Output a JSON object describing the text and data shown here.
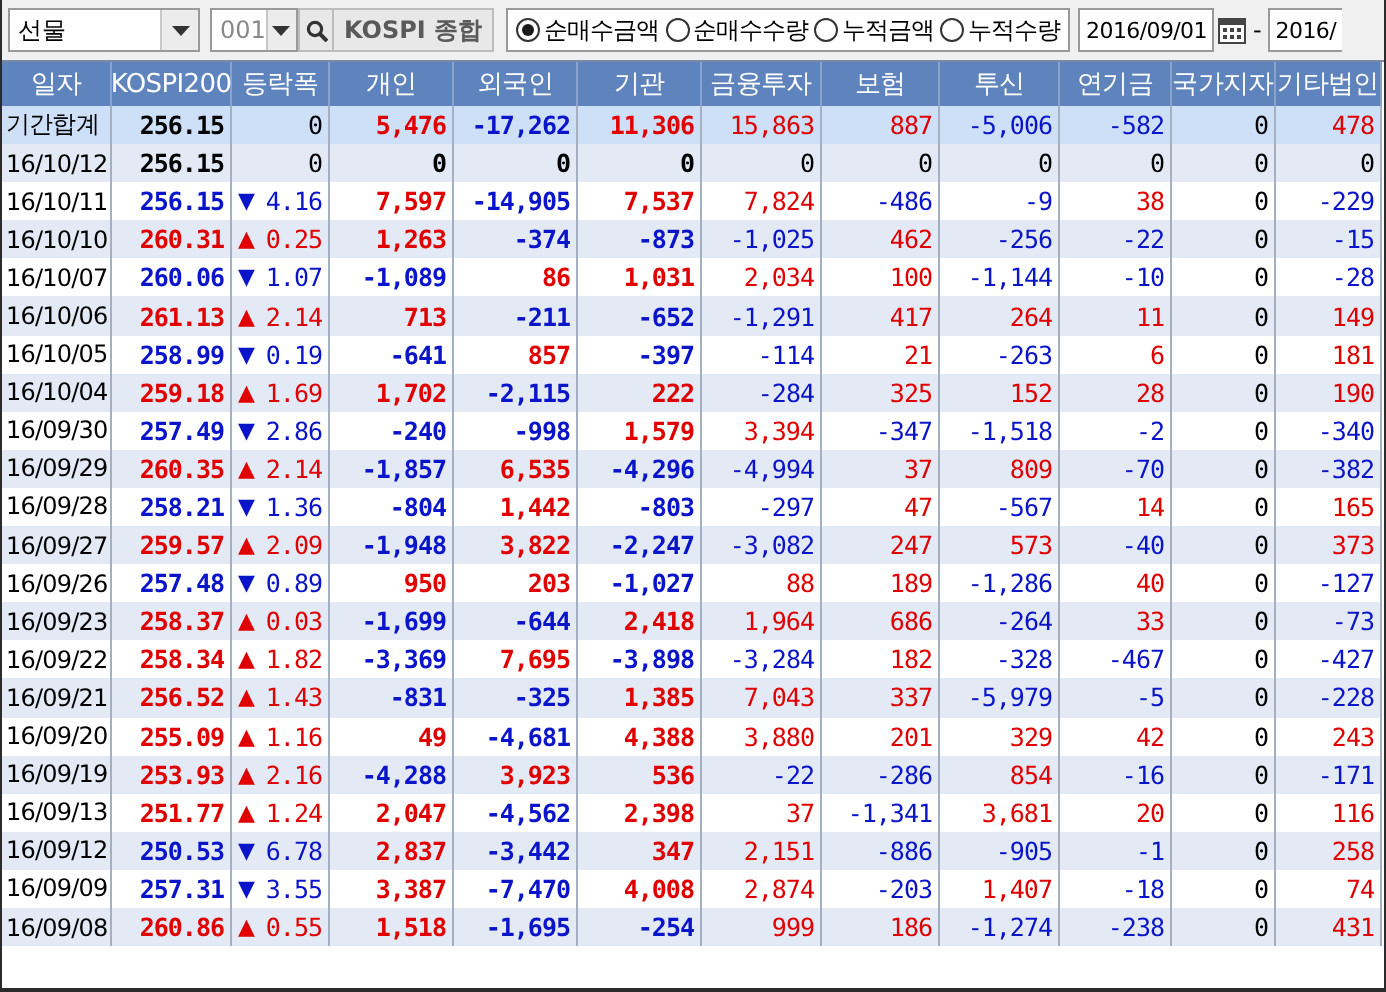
{
  "toolbar": {
    "market_select": "선물",
    "code_field": "001",
    "index_name": "KOSPI 종합",
    "options": [
      {
        "label": "순매수금액",
        "selected": true
      },
      {
        "label": "순매수수량",
        "selected": false
      },
      {
        "label": "누적금액",
        "selected": false
      },
      {
        "label": "누적수량",
        "selected": false
      }
    ],
    "start_date": "2016/09/01",
    "range_separator": "-",
    "end_date": "2016/"
  },
  "table": {
    "columns": [
      "일자",
      "KOSPI200",
      "등락폭",
      "개인",
      "외국인",
      "기관",
      "금융투자",
      "보험",
      "투신",
      "연기금",
      "국가지자",
      "기타법인"
    ],
    "rows": [
      {
        "kind": "total",
        "date": "기간합계",
        "kospi200": "256.15",
        "change": "0",
        "values": [
          "5,476",
          "-17,262",
          "11,306",
          "15,863",
          "887",
          "-5,006",
          "-582",
          "0",
          "478"
        ]
      },
      {
        "kind": "day",
        "date": "16/10/12",
        "kospi200": "256.15",
        "change": "0",
        "values": [
          "0",
          "0",
          "0",
          "0",
          "0",
          "0",
          "0",
          "0",
          "0"
        ]
      },
      {
        "kind": "day",
        "date": "16/10/11",
        "kospi200": "256.15",
        "arrow": "▼",
        "rising": false,
        "change": "4.16",
        "values": [
          "7,597",
          "-14,905",
          "7,537",
          "7,824",
          "-486",
          "-9",
          "38",
          "0",
          "-229"
        ]
      },
      {
        "kind": "day",
        "date": "16/10/10",
        "kospi200": "260.31",
        "arrow": "▲",
        "rising": true,
        "change": "0.25",
        "values": [
          "1,263",
          "-374",
          "-873",
          "-1,025",
          "462",
          "-256",
          "-22",
          "0",
          "-15"
        ]
      },
      {
        "kind": "day",
        "date": "16/10/07",
        "kospi200": "260.06",
        "arrow": "▼",
        "rising": false,
        "change": "1.07",
        "values": [
          "-1,089",
          "86",
          "1,031",
          "2,034",
          "100",
          "-1,144",
          "-10",
          "0",
          "-28"
        ]
      },
      {
        "kind": "day",
        "date": "16/10/06",
        "kospi200": "261.13",
        "arrow": "▲",
        "rising": true,
        "change": "2.14",
        "values": [
          "713",
          "-211",
          "-652",
          "-1,291",
          "417",
          "264",
          "11",
          "0",
          "149"
        ]
      },
      {
        "kind": "day",
        "date": "16/10/05",
        "kospi200": "258.99",
        "arrow": "▼",
        "rising": false,
        "change": "0.19",
        "values": [
          "-641",
          "857",
          "-397",
          "-114",
          "21",
          "-263",
          "6",
          "0",
          "181"
        ]
      },
      {
        "kind": "day",
        "date": "16/10/04",
        "kospi200": "259.18",
        "arrow": "▲",
        "rising": true,
        "change": "1.69",
        "values": [
          "1,702",
          "-2,115",
          "222",
          "-284",
          "325",
          "152",
          "28",
          "0",
          "190"
        ]
      },
      {
        "kind": "day",
        "date": "16/09/30",
        "kospi200": "257.49",
        "arrow": "▼",
        "rising": false,
        "change": "2.86",
        "values": [
          "-240",
          "-998",
          "1,579",
          "3,394",
          "-347",
          "-1,518",
          "-2",
          "0",
          "-340"
        ]
      },
      {
        "kind": "day",
        "date": "16/09/29",
        "kospi200": "260.35",
        "arrow": "▲",
        "rising": true,
        "change": "2.14",
        "values": [
          "-1,857",
          "6,535",
          "-4,296",
          "-4,994",
          "37",
          "809",
          "-70",
          "0",
          "-382"
        ]
      },
      {
        "kind": "day",
        "date": "16/09/28",
        "kospi200": "258.21",
        "arrow": "▼",
        "rising": false,
        "change": "1.36",
        "values": [
          "-804",
          "1,442",
          "-803",
          "-297",
          "47",
          "-567",
          "14",
          "0",
          "165"
        ]
      },
      {
        "kind": "day",
        "date": "16/09/27",
        "kospi200": "259.57",
        "arrow": "▲",
        "rising": true,
        "change": "2.09",
        "values": [
          "-1,948",
          "3,822",
          "-2,247",
          "-3,082",
          "247",
          "573",
          "-40",
          "0",
          "373"
        ]
      },
      {
        "kind": "day",
        "date": "16/09/26",
        "kospi200": "257.48",
        "arrow": "▼",
        "rising": false,
        "change": "0.89",
        "values": [
          "950",
          "203",
          "-1,027",
          "88",
          "189",
          "-1,286",
          "40",
          "0",
          "-127"
        ]
      },
      {
        "kind": "day",
        "date": "16/09/23",
        "kospi200": "258.37",
        "arrow": "▲",
        "rising": true,
        "change": "0.03",
        "values": [
          "-1,699",
          "-644",
          "2,418",
          "1,964",
          "686",
          "-264",
          "33",
          "0",
          "-73"
        ]
      },
      {
        "kind": "day",
        "date": "16/09/22",
        "kospi200": "258.34",
        "arrow": "▲",
        "rising": true,
        "change": "1.82",
        "values": [
          "-3,369",
          "7,695",
          "-3,898",
          "-3,284",
          "182",
          "-328",
          "-467",
          "0",
          "-427"
        ]
      },
      {
        "kind": "day",
        "date": "16/09/21",
        "kospi200": "256.52",
        "arrow": "▲",
        "rising": true,
        "change": "1.43",
        "values": [
          "-831",
          "-325",
          "1,385",
          "7,043",
          "337",
          "-5,979",
          "-5",
          "0",
          "-228"
        ]
      },
      {
        "kind": "day",
        "date": "16/09/20",
        "kospi200": "255.09",
        "arrow": "▲",
        "rising": true,
        "change": "1.16",
        "values": [
          "49",
          "-4,681",
          "4,388",
          "3,880",
          "201",
          "329",
          "42",
          "0",
          "243"
        ]
      },
      {
        "kind": "day",
        "date": "16/09/19",
        "kospi200": "253.93",
        "arrow": "▲",
        "rising": true,
        "change": "2.16",
        "values": [
          "-4,288",
          "3,923",
          "536",
          "-22",
          "-286",
          "854",
          "-16",
          "0",
          "-171"
        ]
      },
      {
        "kind": "day",
        "date": "16/09/13",
        "kospi200": "251.77",
        "arrow": "▲",
        "rising": true,
        "change": "1.24",
        "values": [
          "2,047",
          "-4,562",
          "2,398",
          "37",
          "-1,341",
          "3,681",
          "20",
          "0",
          "116"
        ]
      },
      {
        "kind": "day",
        "date": "16/09/12",
        "kospi200": "250.53",
        "arrow": "▼",
        "rising": false,
        "change": "6.78",
        "values": [
          "2,837",
          "-3,442",
          "347",
          "2,151",
          "-886",
          "-905",
          "-1",
          "0",
          "258"
        ]
      },
      {
        "kind": "day",
        "date": "16/09/09",
        "kospi200": "257.31",
        "arrow": "▼",
        "rising": false,
        "change": "3.55",
        "values": [
          "3,387",
          "-7,470",
          "4,008",
          "2,874",
          "-203",
          "1,407",
          "-18",
          "0",
          "74"
        ]
      },
      {
        "kind": "day",
        "date": "16/09/08",
        "kospi200": "260.86",
        "arrow": "▲",
        "rising": true,
        "change": "0.55",
        "values": [
          "1,518",
          "-1,695",
          "-254",
          "999",
          "186",
          "-1,274",
          "-238",
          "0",
          "431"
        ]
      }
    ]
  }
}
